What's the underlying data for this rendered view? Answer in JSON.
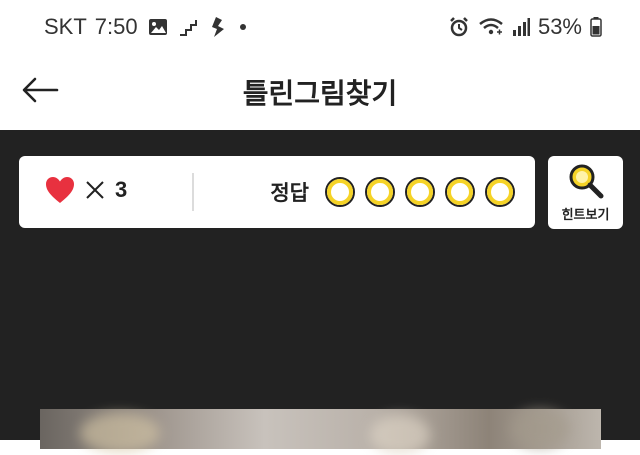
{
  "status_bar": {
    "carrier": "SKT",
    "time": "7:50",
    "battery": "53%",
    "icons_left": [
      "gallery-icon",
      "step-icon",
      "game-icon",
      "dot-icon"
    ],
    "icons_right": [
      "alarm-icon",
      "wifi-icon",
      "signal-icon",
      "battery-icon"
    ]
  },
  "header": {
    "title": "틀린그림찾기",
    "back_icon": "back-arrow-icon"
  },
  "game": {
    "lives_count": "3",
    "lives_icon": "heart-icon",
    "times_symbol": "×",
    "answer_label": "정답",
    "answer_slots": 5,
    "hint_label": "힌트보기",
    "hint_icon": "magnifier-icon"
  },
  "colors": {
    "game_bg": "#222222",
    "heart": "#e8313f",
    "answer_ring": "#f5d327",
    "answer_ring_border": "#222222",
    "hint_icon": "#f5d327"
  }
}
